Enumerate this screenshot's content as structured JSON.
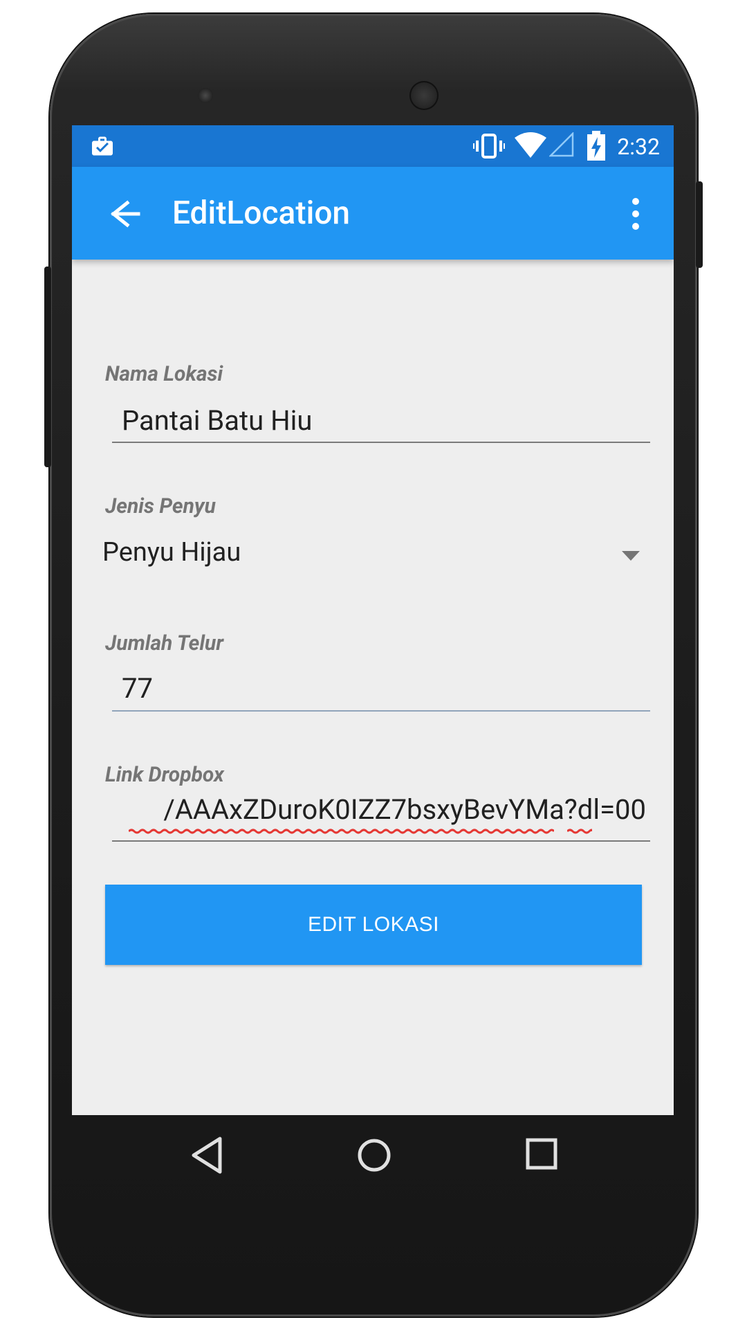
{
  "status_bar": {
    "time": "2:32",
    "icons": [
      "briefcase-check-icon",
      "vibrate-icon",
      "wifi-icon",
      "signal-icon",
      "battery-charging-icon"
    ]
  },
  "app_bar": {
    "title": "EditLocation",
    "back_icon": "arrow-back-icon",
    "menu_icon": "more-vert-icon"
  },
  "form": {
    "nama_lokasi": {
      "label": "Nama Lokasi",
      "value": "Pantai Batu Hiu"
    },
    "jenis_penyu": {
      "label": "Jenis Penyu",
      "selected": "Penyu Hijau"
    },
    "jumlah_telur": {
      "label": "Jumlah Telur",
      "value": "77"
    },
    "link_dropbox": {
      "label": "Link Dropbox",
      "value": "/AAAxZDuroK0IZZ7bsxyBevYMa?dl=00"
    },
    "submit_label": "EDIT LOKASI"
  },
  "nav_bar": {
    "icons": [
      "back-triangle-icon",
      "home-circle-icon",
      "recents-square-icon"
    ]
  },
  "colors": {
    "primary": "#2196f3",
    "primary_dark": "#1976d2",
    "background": "#eeeeee"
  }
}
